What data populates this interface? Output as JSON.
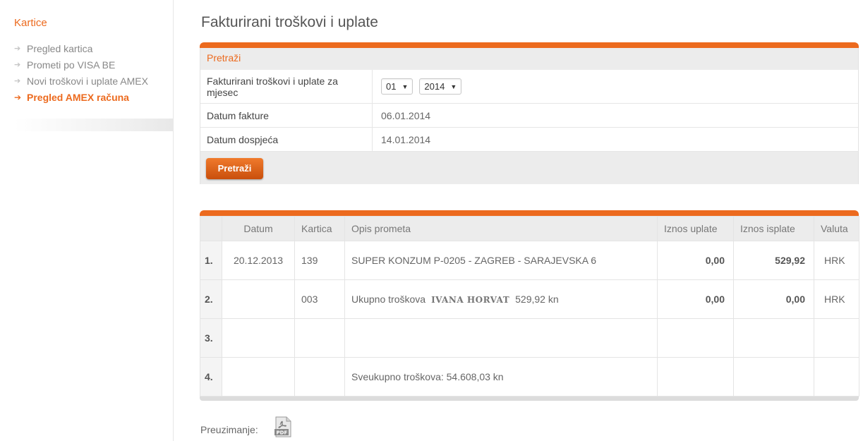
{
  "sidebar": {
    "title": "Kartice",
    "items": [
      {
        "label": "Pregled kartica",
        "active": false
      },
      {
        "label": "Prometi po VISA BE",
        "active": false
      },
      {
        "label": "Novi troškovi i uplate AMEX",
        "active": false
      },
      {
        "label": "Pregled AMEX računa",
        "active": true
      }
    ]
  },
  "page": {
    "title": "Fakturirani troškovi i uplate"
  },
  "search": {
    "header": "Pretraži",
    "month_label": "Fakturirani troškovi i uplate za mjesec",
    "month_value": "01",
    "year_value": "2014",
    "invoice_date_label": "Datum fakture",
    "invoice_date": "06.01.2014",
    "due_date_label": "Datum dospjeća",
    "due_date": "14.01.2014",
    "button_label": "Pretraži"
  },
  "table": {
    "headers": [
      "",
      "Datum",
      "Kartica",
      "Opis prometa",
      "Iznos uplate",
      "Iznos isplate",
      "Valuta"
    ],
    "rows": [
      {
        "num": "1.",
        "date": "20.12.2013",
        "card": "139",
        "desc": "SUPER KONZUM P-0205 - ZAGREB - SARAJEVSKA 6",
        "payment": "0,00",
        "payout": "529,92",
        "currency": "HRK"
      },
      {
        "num": "2.",
        "date": "",
        "card": "003",
        "desc_prefix": "Ukupno troškova",
        "desc_name": "IVANA HORVAT",
        "desc_suffix": "529,92 kn",
        "payment": "0,00",
        "payout": "0,00",
        "currency": "HRK"
      },
      {
        "num": "3.",
        "date": "",
        "card": "",
        "desc": "",
        "payment": "",
        "payout": "",
        "currency": ""
      },
      {
        "num": "4.",
        "date": "",
        "card": "",
        "desc": "Sveukupno troškova: 54.608,03 kn",
        "payment": "",
        "payout": "",
        "currency": ""
      }
    ]
  },
  "download": {
    "label": "Preuzimanje:",
    "icon": "pdf-icon",
    "icon_text": "PDF"
  },
  "colors": {
    "accent": "#ec6a1e",
    "panel_bg": "#ececec"
  }
}
